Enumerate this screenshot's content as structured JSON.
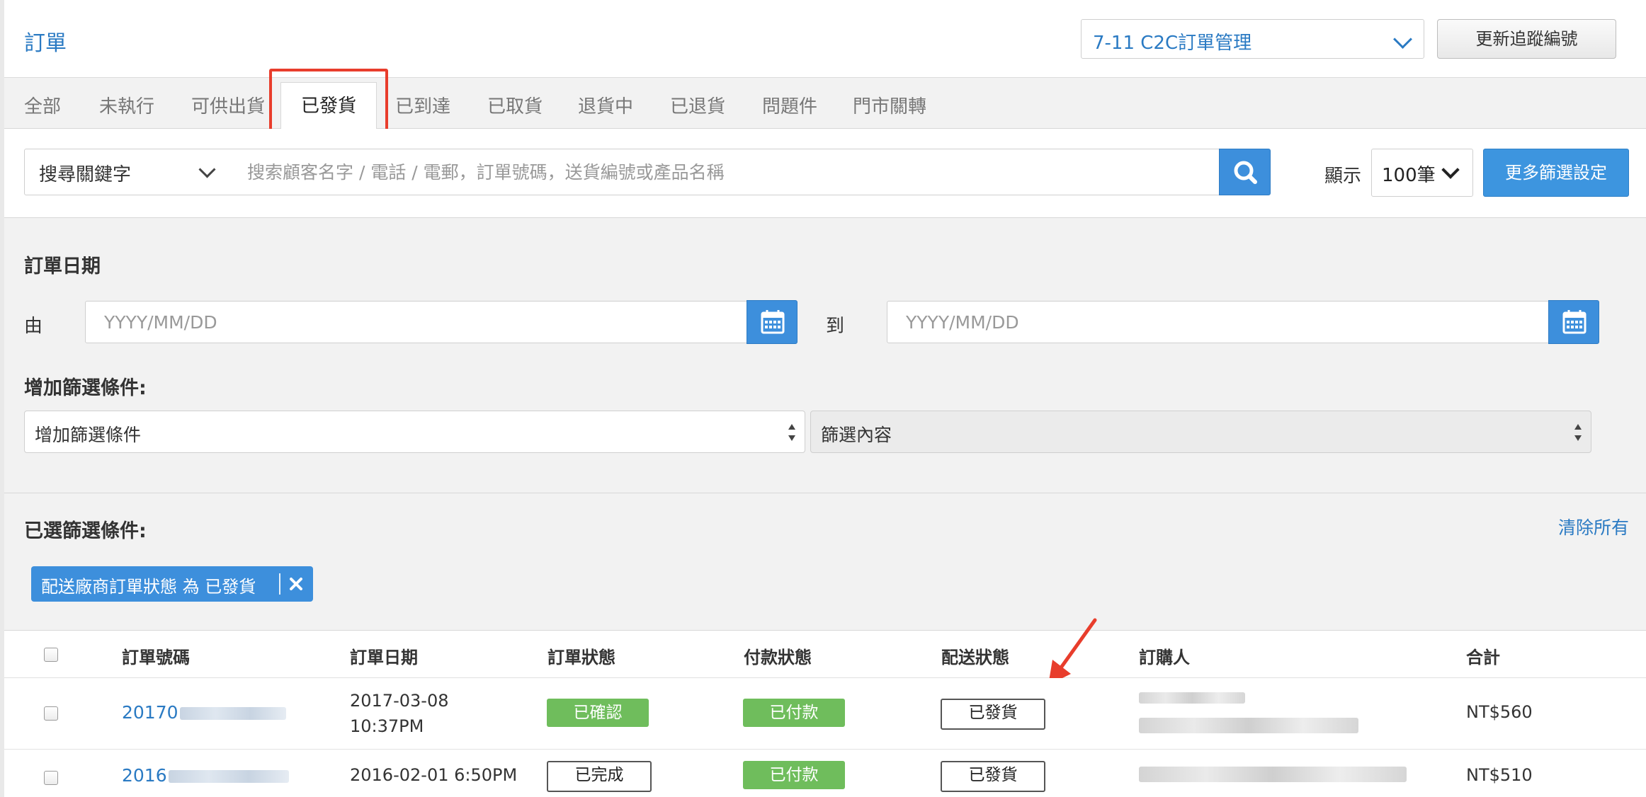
{
  "header": {
    "title": "訂單",
    "store_select": "7-11 C2C訂單管理",
    "update_button": "更新追蹤編號"
  },
  "tabs": [
    {
      "label": "全部"
    },
    {
      "label": "未執行"
    },
    {
      "label": "可供出貨"
    },
    {
      "label": "已發貨",
      "active": true
    },
    {
      "label": "已到達"
    },
    {
      "label": "已取貨"
    },
    {
      "label": "退貨中"
    },
    {
      "label": "已退貨"
    },
    {
      "label": "問題件"
    },
    {
      "label": "門市關轉"
    }
  ],
  "search": {
    "keyword_select": "搜尋關鍵字",
    "placeholder": "搜索顧客名字 / 電話 / 電郵，訂單號碼，送貨編號或產品名稱",
    "show_label": "顯示",
    "per_page": "100筆",
    "more_filters": "更多篩選設定"
  },
  "filters": {
    "date_heading": "訂單日期",
    "from_label": "由",
    "to_label": "到",
    "date_placeholder": "YYYY/MM/DD",
    "add_heading": "增加篩選條件:",
    "add_select": "增加篩選條件",
    "content_select": "篩選內容",
    "selected_heading": "已選篩選條件:",
    "clear_all": "清除所有",
    "chip": "配送廠商訂單狀態 為 已發貨"
  },
  "table": {
    "headers": [
      "訂單號碼",
      "訂單日期",
      "訂單狀態",
      "付款狀態",
      "配送狀態",
      "訂購人",
      "合計"
    ],
    "rows": [
      {
        "order_prefix": "20170",
        "date_line1": "2017-03-08",
        "date_line2": "10:37PM",
        "status": "已確認",
        "payment": "已付款",
        "delivery": "已發貨",
        "total": "NT$560"
      },
      {
        "order_prefix": "2016",
        "date_line1": "2016-02-01 6:50PM",
        "date_line2": "",
        "status": "已完成",
        "payment": "已付款",
        "delivery": "已發貨",
        "total": "NT$510"
      }
    ]
  },
  "colors": {
    "accent": "#3d8fdc",
    "link": "#2a7ac3",
    "success": "#6fbd5c",
    "highlight": "#e83d2c"
  }
}
